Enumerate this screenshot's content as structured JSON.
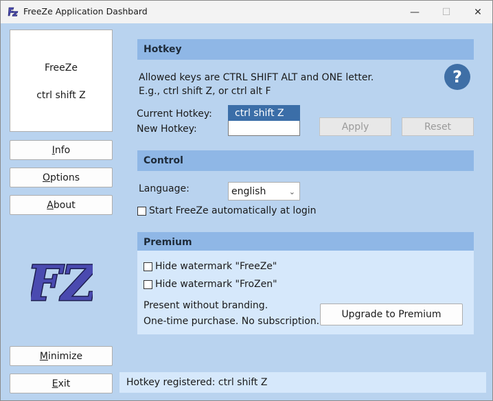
{
  "window": {
    "title": "FreeZe Application Dashbard",
    "minimize_glyph": "—",
    "maximize_glyph": "☐",
    "close_glyph": "✕"
  },
  "preview": {
    "name": "FreeZe",
    "hotkey": "ctrl shift Z"
  },
  "sidebar": {
    "info": {
      "first": "I",
      "rest": "nfo"
    },
    "options": {
      "first": "O",
      "rest": "ptions"
    },
    "about": {
      "first": "A",
      "rest": "bout"
    },
    "minimize": {
      "first": "M",
      "rest": "inimize"
    },
    "exit": {
      "first": "E",
      "rest": "xit"
    }
  },
  "logo": {
    "text": "FZ"
  },
  "hotkey": {
    "header": "Hotkey",
    "allowed_line1": "Allowed keys are CTRL SHIFT ALT and ONE letter.",
    "allowed_line2": "E.g., ctrl shift Z, or ctrl alt F",
    "help_glyph": "?",
    "current_label": "Current Hotkey:",
    "current_value": "ctrl shift Z",
    "new_label": "New Hotkey:",
    "new_value": "",
    "apply_label": "Apply",
    "reset_label": "Reset"
  },
  "control": {
    "header": "Control",
    "language_label": "Language:",
    "language_value": "english",
    "autostart_label": "Start FreeZe automatically at login",
    "autostart_checked": false
  },
  "premium": {
    "header": "Premium",
    "hide_freeze_label": "Hide watermark \"FreeZe\"",
    "hide_frozen_label": "Hide watermark \"FroZen\"",
    "line1": "Present without branding.",
    "line2": "One-time purchase. No subscription.",
    "upgrade_label": "Upgrade to Premium"
  },
  "status": {
    "text": "Hotkey registered: ctrl shift Z"
  },
  "colors": {
    "window_bg": "#b9d3ef",
    "section_header": "#8fb7e6",
    "selection": "#3b6ea8",
    "help_button": "#3f6fa6",
    "logo_fill": "#4a4ab0"
  }
}
